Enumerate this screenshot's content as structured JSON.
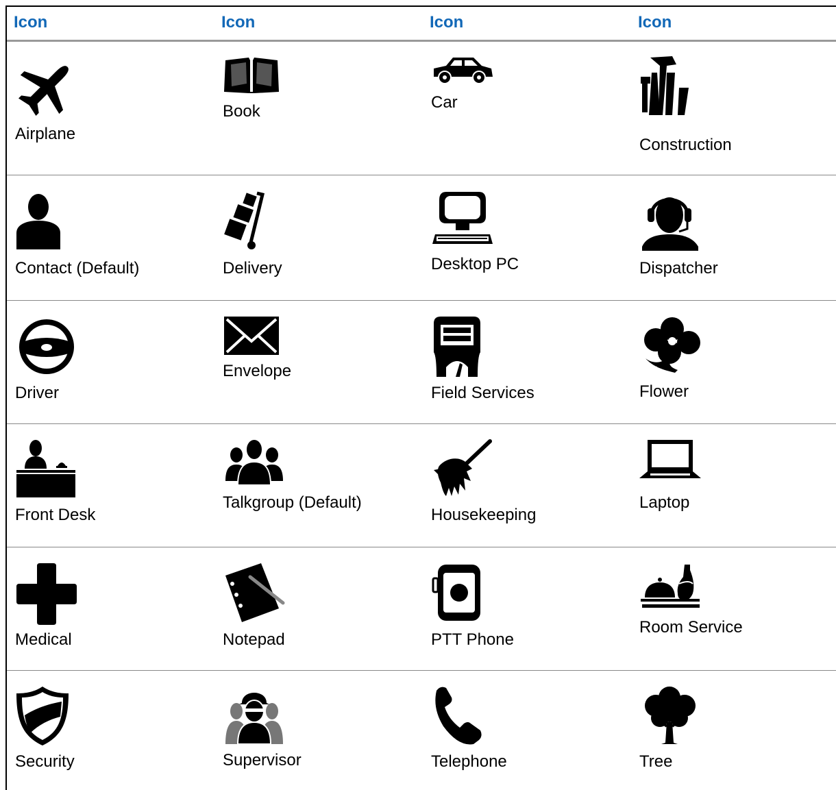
{
  "header": {
    "columns": [
      "Icon",
      "Icon",
      "Icon",
      "Icon"
    ]
  },
  "rows": [
    [
      {
        "label": "Airplane",
        "icon": "airplane-icon"
      },
      {
        "label": "Book",
        "icon": "book-icon"
      },
      {
        "label": "Car",
        "icon": "car-icon"
      },
      {
        "label": "Construction",
        "icon": "construction-icon"
      }
    ],
    [
      {
        "label": "Contact (Default)",
        "icon": "contact-icon"
      },
      {
        "label": "Delivery",
        "icon": "delivery-icon"
      },
      {
        "label": "Desktop PC",
        "icon": "desktop-pc-icon"
      },
      {
        "label": "Dispatcher",
        "icon": "dispatcher-icon"
      }
    ],
    [
      {
        "label": "Driver",
        "icon": "driver-icon"
      },
      {
        "label": "Envelope",
        "icon": "envelope-icon"
      },
      {
        "label": "Field Services",
        "icon": "field-services-icon"
      },
      {
        "label": "Flower",
        "icon": "flower-icon"
      }
    ],
    [
      {
        "label": "Front Desk",
        "icon": "front-desk-icon"
      },
      {
        "label": "Talkgroup (Default)",
        "icon": "talkgroup-icon"
      },
      {
        "label": "Housekeeping",
        "icon": "housekeeping-icon"
      },
      {
        "label": "Laptop",
        "icon": "laptop-icon"
      }
    ],
    [
      {
        "label": "Medical",
        "icon": "medical-icon"
      },
      {
        "label": "Notepad",
        "icon": "notepad-icon"
      },
      {
        "label": "PTT Phone",
        "icon": "ptt-phone-icon"
      },
      {
        "label": "Room Service",
        "icon": "room-service-icon"
      }
    ],
    [
      {
        "label": "Security",
        "icon": "security-icon"
      },
      {
        "label": "Supervisor",
        "icon": "supervisor-icon"
      },
      {
        "label": "Telephone",
        "icon": "telephone-icon"
      },
      {
        "label": "Tree",
        "icon": "tree-icon"
      }
    ]
  ],
  "colors": {
    "header_text": "#1268b7",
    "header_rule": "#999999",
    "row_rule": "#888888"
  }
}
